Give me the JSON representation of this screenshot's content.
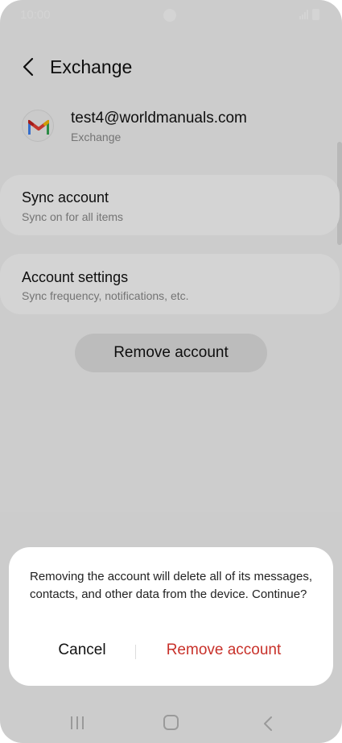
{
  "status_bar": {
    "time": "10:00"
  },
  "header": {
    "title": "Exchange"
  },
  "account": {
    "email": "test4@worldmanuals.com",
    "type": "Exchange"
  },
  "sync": {
    "title": "Sync account",
    "subtitle": "Sync on for all items"
  },
  "settings": {
    "title": "Account settings",
    "subtitle": "Sync frequency, notifications, etc."
  },
  "remove_button": {
    "label": "Remove account"
  },
  "dialog": {
    "message": "Removing the account will delete all of its messages, contacts, and other data from the device. Continue?",
    "cancel_label": "Cancel",
    "confirm_label": "Remove account"
  },
  "icons": {
    "back": "chevron-left-icon",
    "avatar": "gmail-icon",
    "nav_recent": "recent-apps-icon",
    "nav_home": "home-icon",
    "nav_back": "back-icon"
  },
  "colors": {
    "accent_destructive": "#c8312a",
    "card_bg": "#ffffff",
    "screen_bg": "#f6f6f6"
  }
}
